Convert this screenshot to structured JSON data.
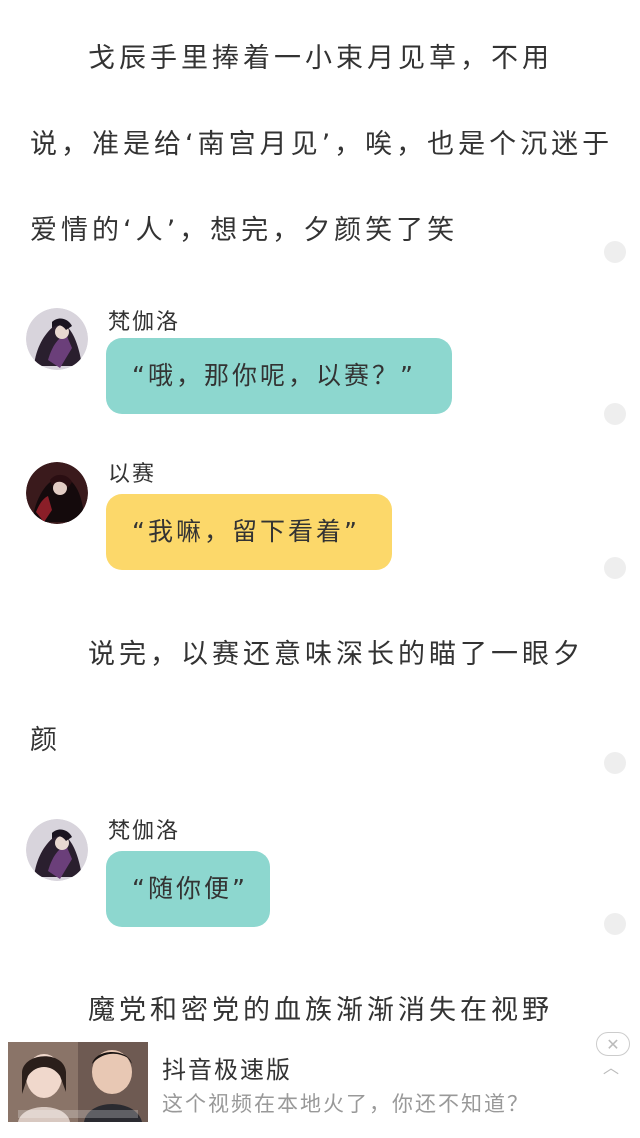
{
  "story": {
    "para1": [
      "戈辰手里捧着一小束月见草，不用",
      "说，准是给‘南宫月见’，唉，也是个沉迷于",
      "爱情的‘人’，想完，夕颜笑了笑"
    ],
    "para2": [
      "说完，以赛还意味深长的瞄了一眼夕",
      "颜"
    ],
    "para3": [
      "魔党和密党的血族渐渐消失在视野"
    ]
  },
  "chats": [
    {
      "speaker": "梵伽洛",
      "text": "“哦，那你呢，以赛？”",
      "bubble_color": "#8dd7cf"
    },
    {
      "speaker": "以赛",
      "text": "“我嘛，留下看着”",
      "bubble_color": "#fcd86a"
    },
    {
      "speaker": "梵伽洛",
      "text": "“随你便”",
      "bubble_color": "#8dd7cf"
    }
  ],
  "ad": {
    "title": "抖音极速版",
    "subtitle": "这个视频在本地火了，你还不知道？",
    "close_icon": "close-icon",
    "collapse_icon": "chevron-up-icon"
  }
}
